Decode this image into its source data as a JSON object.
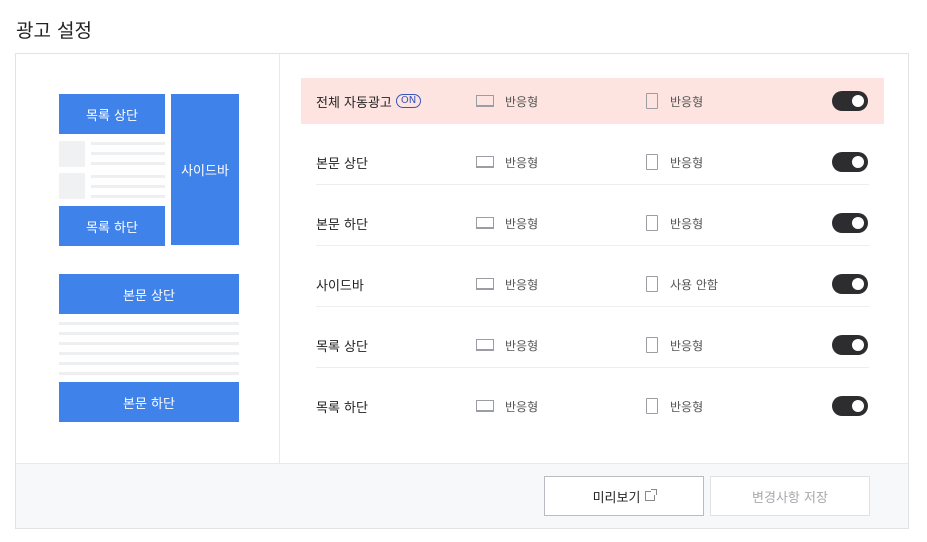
{
  "page": {
    "title": "광고 설정"
  },
  "preview": {
    "list_top": "목록 상단",
    "list_bottom": "목록 하단",
    "sidebar": "사이드바",
    "body_top": "본문 상단",
    "body_bottom": "본문 하단"
  },
  "rows": [
    {
      "label": "전체 자동광고",
      "badge": "ON",
      "pc": "반응형",
      "mobile": "반응형",
      "enabled": true
    },
    {
      "label": "본문 상단",
      "pc": "반응형",
      "mobile": "반응형",
      "enabled": true
    },
    {
      "label": "본문 하단",
      "pc": "반응형",
      "mobile": "반응형",
      "enabled": true
    },
    {
      "label": "사이드바",
      "pc": "반응형",
      "mobile": "사용 안함",
      "enabled": true
    },
    {
      "label": "목록 상단",
      "pc": "반응형",
      "mobile": "반응형",
      "enabled": true
    },
    {
      "label": "목록 하단",
      "pc": "반응형",
      "mobile": "반응형",
      "enabled": true
    }
  ],
  "footer": {
    "preview_label": "미리보기",
    "save_label": "변경사항 저장"
  },
  "icons": {
    "pc": "monitor-icon",
    "mobile": "phone-icon",
    "external": "external-link-icon"
  },
  "colors": {
    "accent": "#3f82e9",
    "highlight": "#fde4e1",
    "toggle_on": "#2d2d2f"
  }
}
